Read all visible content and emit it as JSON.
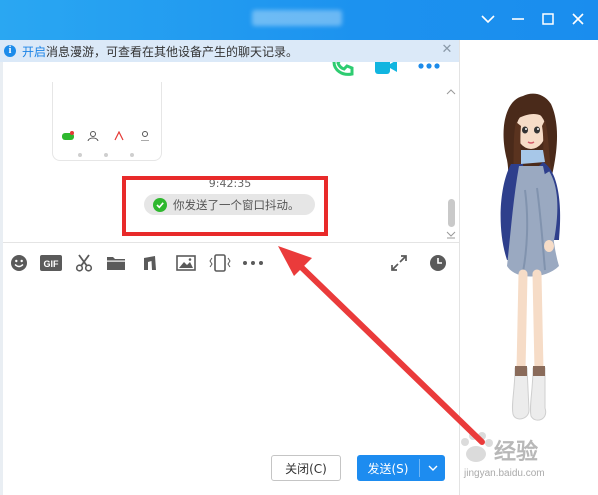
{
  "notice": {
    "link_text": "开启",
    "message": "消息漫游，可查看在其他设备产生的聊天记录。"
  },
  "chat": {
    "timestamp": "9:42:35",
    "system_message": "你发送了一个窗口抖动。"
  },
  "buttons": {
    "close_label": "关闭(C)",
    "send_label": "发送(S)"
  },
  "watermark": {
    "brand_text": "经验",
    "url": "jingyan.baidu.com"
  },
  "icons": [
    "phone-call-icon",
    "video-call-icon",
    "more-icon",
    "emoji-icon",
    "gif-icon",
    "scissors-icon",
    "folder-icon",
    "music-icon",
    "image-icon",
    "window-shake-icon",
    "more-tools-icon",
    "expand-icon",
    "history-icon"
  ],
  "colors": {
    "title_bar": "#1a8dee",
    "notice_bg": "#dbe9f8",
    "highlight_box": "#e82a2a",
    "send_button": "#1d8cf0",
    "success_check": "#2eb82e",
    "call_green": "#2ecc71",
    "video_cyan": "#11b5e0"
  }
}
